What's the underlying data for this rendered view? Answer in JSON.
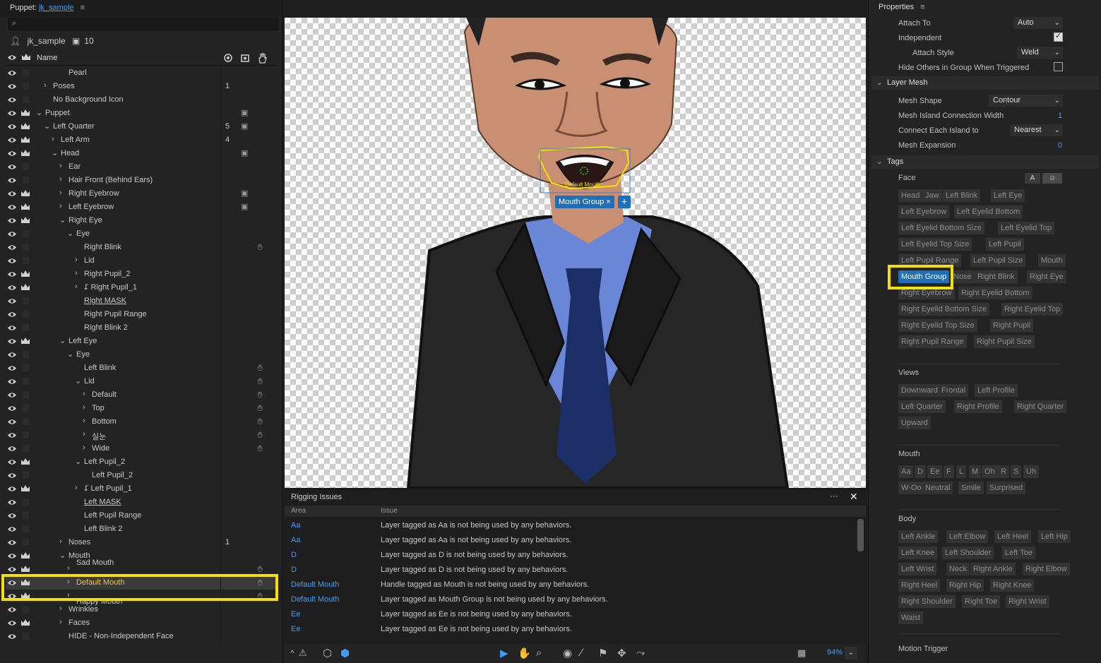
{
  "left_panel": {
    "title_prefix": "Puppet:",
    "document": "jk_sample",
    "menu_icon": "≡",
    "puppet_name": "jk_sample",
    "puppet_count": "10",
    "column_name": "Name",
    "rows": [
      {
        "label": "Pearl",
        "indent": 7,
        "arrow": "",
        "crown": false
      },
      {
        "label": "Poses",
        "indent": 5,
        "arrow": "›",
        "crown": false,
        "count": "1"
      },
      {
        "label": "No Background Icon",
        "indent": 5,
        "arrow": "",
        "crown": false
      },
      {
        "label": "Puppet",
        "indent": 4,
        "arrow": "⌄",
        "crown": true,
        "c2": "cam"
      },
      {
        "label": "Left Quarter",
        "indent": 5,
        "arrow": "⌄",
        "crown": true,
        "count": "5",
        "c2": "cam"
      },
      {
        "label": "Left Arm",
        "indent": 6,
        "arrow": "›",
        "crown": true,
        "count": "4"
      },
      {
        "label": "Head",
        "indent": 6,
        "arrow": "⌄",
        "crown": true,
        "c2": "cam"
      },
      {
        "label": "Ear",
        "indent": 7,
        "arrow": "›",
        "crown": false
      },
      {
        "label": "Hair Front (Behind Ears)",
        "indent": 7,
        "arrow": "›",
        "crown": false
      },
      {
        "label": "Right Eyebrow",
        "indent": 7,
        "arrow": "›",
        "crown": true,
        "c2": "cam"
      },
      {
        "label": "Left Eyebrow",
        "indent": 7,
        "arrow": "›",
        "crown": true,
        "c2": "cam"
      },
      {
        "label": "Right Eye",
        "indent": 7,
        "arrow": "⌄",
        "crown": true
      },
      {
        "label": "Eye",
        "indent": 8,
        "arrow": "⌄",
        "crown": false
      },
      {
        "label": "Right Blink",
        "indent": 9,
        "arrow": "",
        "crown": false,
        "c3": "hand"
      },
      {
        "label": "Lid",
        "indent": 9,
        "arrow": "›",
        "crown": false
      },
      {
        "label": "Right Pupil_2",
        "indent": 9,
        "arrow": "›",
        "crown": true
      },
      {
        "label": "⮦ Right Pupil_1",
        "indent": 9,
        "arrow": "›",
        "crown": true
      },
      {
        "label": "Right MASK",
        "indent": 9,
        "arrow": "",
        "crown": false,
        "underline": true
      },
      {
        "label": "Right Pupil Range",
        "indent": 9,
        "arrow": "",
        "crown": false
      },
      {
        "label": "Right Blink 2",
        "indent": 9,
        "arrow": "",
        "crown": false
      },
      {
        "label": "Left Eye",
        "indent": 7,
        "arrow": "⌄",
        "crown": true
      },
      {
        "label": "Eye",
        "indent": 8,
        "arrow": "⌄",
        "crown": false
      },
      {
        "label": "Left Blink",
        "indent": 9,
        "arrow": "",
        "crown": false,
        "c3": "hand"
      },
      {
        "label": "Lid",
        "indent": 9,
        "arrow": "⌄",
        "crown": false,
        "c3": "hand"
      },
      {
        "label": "Default",
        "indent": 10,
        "arrow": "›",
        "crown": false,
        "c3": "hand"
      },
      {
        "label": "Top",
        "indent": 10,
        "arrow": "›",
        "crown": false,
        "c3": "hand"
      },
      {
        "label": "Bottom",
        "indent": 10,
        "arrow": "›",
        "crown": false,
        "c3": "hand"
      },
      {
        "label": "실눈",
        "indent": 10,
        "arrow": "›",
        "crown": false,
        "c3": "hand"
      },
      {
        "label": "Wide",
        "indent": 10,
        "arrow": "›",
        "crown": false,
        "c3": "hand"
      },
      {
        "label": "Left Pupil_2",
        "indent": 9,
        "arrow": "⌄",
        "crown": true
      },
      {
        "label": "Left Pupil_2",
        "indent": 10,
        "arrow": "",
        "crown": false
      },
      {
        "label": "⮦ Left Pupil_1",
        "indent": 9,
        "arrow": "›",
        "crown": true
      },
      {
        "label": "Left MASK",
        "indent": 9,
        "arrow": "",
        "crown": false,
        "underline": true
      },
      {
        "label": "Left Pupil Range",
        "indent": 9,
        "arrow": "",
        "crown": false
      },
      {
        "label": "Left Blink 2",
        "indent": 9,
        "arrow": "",
        "crown": false
      },
      {
        "label": "Noses",
        "indent": 7,
        "arrow": "›",
        "crown": false,
        "count": "1"
      },
      {
        "label": "Mouth",
        "indent": 7,
        "arrow": "⌄",
        "crown": true
      },
      {
        "label": "Sad Mouth",
        "indent": 8,
        "arrow": "›",
        "crown": true,
        "c3": "hand",
        "partial": true
      },
      {
        "label": "Default Mouth",
        "indent": 8,
        "arrow": "›",
        "crown": true,
        "c3": "hand",
        "selected": true
      },
      {
        "label": "Happy Mouth",
        "indent": 8,
        "arrow": "›",
        "crown": true,
        "c3": "hand",
        "partial": true
      },
      {
        "label": "Wrinkles",
        "indent": 7,
        "arrow": "›",
        "crown": false
      },
      {
        "label": "Faces",
        "indent": 7,
        "arrow": "›",
        "crown": true
      },
      {
        "label": "HIDE - Non-Independent Face",
        "indent": 7,
        "arrow": "",
        "crown": false
      }
    ]
  },
  "canvas": {
    "handle_label": "Default Mouth",
    "tag_chip": "Mouth Group ×",
    "tag_add": "+"
  },
  "issues": {
    "title": "Rigging Issues",
    "more": "···",
    "close": "✕",
    "col_area": "Area",
    "col_issue": "Issue",
    "rows": [
      {
        "area": "Aa",
        "issue": "Layer tagged as Aa is not being used by any behaviors."
      },
      {
        "area": "Aa",
        "issue": "Layer tagged as Aa is not being used by any behaviors."
      },
      {
        "area": "D",
        "issue": "Layer tagged as D is not being used by any behaviors."
      },
      {
        "area": "D",
        "issue": "Layer tagged as D is not being used by any behaviors."
      },
      {
        "area": "Default Mouth",
        "issue": "Handle tagged as Mouth is not being used by any behaviors."
      },
      {
        "area": "Default Mouth",
        "issue": "Layer tagged as Mouth Group is not being used by any behaviors."
      },
      {
        "area": "Ee",
        "issue": "Layer tagged as Ee is not being used by any behaviors."
      },
      {
        "area": "Ee",
        "issue": "Layer tagged as Ee is not being used by any behaviors."
      }
    ]
  },
  "toolbar": {
    "zoom": "94%"
  },
  "properties": {
    "title": "Properties",
    "attach_to_label": "Attach To",
    "attach_to_value": "Auto",
    "independent_label": "Independent",
    "independent_checked": true,
    "attach_style_label": "Attach Style",
    "attach_style_value": "Weld",
    "hide_others_label": "Hide Others in Group When Triggered",
    "hide_others_checked": false,
    "layer_mesh_title": "Layer Mesh",
    "mesh_shape_label": "Mesh Shape",
    "mesh_shape_value": "Contour",
    "mesh_island_label": "Mesh Island Connection Width",
    "mesh_island_value": "1",
    "connect_label": "Connect Each Island to",
    "connect_value": "Nearest",
    "mesh_expansion_label": "Mesh Expansion",
    "mesh_expansion_value": "0",
    "tags_title": "Tags",
    "face_group": "Face",
    "face_toggle_a": "A",
    "face_tags": [
      [
        "Head",
        "Jaw",
        "Left Blink",
        "Left Eye"
      ],
      [
        "Left Eyebrow",
        "Left Eyelid Bottom"
      ],
      [
        "Left Eyelid Bottom Size",
        "Left Eyelid Top"
      ],
      [
        "Left Eyelid Top Size",
        "Left Pupil"
      ],
      [
        "Left Pupil Range",
        "Left Pupil Size",
        "Mouth"
      ],
      [
        "Mouth Group",
        "Nose",
        "Right Blink",
        "Right Eye"
      ],
      [
        "Right Eyebrow",
        "Right Eyelid Bottom"
      ],
      [
        "Right Eyelid Bottom Size",
        "Right Eyelid Top"
      ],
      [
        "Right Eyelid Top Size",
        "Right Pupil"
      ],
      [
        "Right Pupil Range",
        "Right Pupil Size"
      ]
    ],
    "active_tag": "Mouth Group",
    "views_group": "Views",
    "views_tags": [
      [
        "Downward",
        "Frontal",
        "Left Profile"
      ],
      [
        "Left Quarter",
        "Right Profile",
        "Right Quarter"
      ],
      [
        "Upward"
      ]
    ],
    "mouth_group": "Mouth",
    "mouth_tags": [
      [
        "Aa",
        "D",
        "Ee",
        "F",
        "L",
        "M",
        "Oh",
        "R",
        "S",
        "Uh"
      ],
      [
        "W-Oo",
        "Neutral",
        "Smile",
        "Surprised"
      ]
    ],
    "body_group": "Body",
    "body_tags": [
      [
        "Left Ankle",
        "Left Elbow",
        "Left Heel",
        "Left Hip"
      ],
      [
        "Left Knee",
        "Left Shoulder",
        "Left Toe"
      ],
      [
        "Left Wrist",
        "Neck",
        "Right Ankle",
        "Right Elbow"
      ],
      [
        "Right Heel",
        "Right Hip",
        "Right Knee"
      ],
      [
        "Right Shoulder",
        "Right Toe",
        "Right Wrist"
      ],
      [
        "Waist"
      ]
    ],
    "motion_trigger_group": "Motion Trigger"
  },
  "colors": {
    "accent": "#3b9ef0",
    "highlight": "#f5e100",
    "selected_text": "#e8c34a",
    "tag_active": "#1f6fb8"
  }
}
